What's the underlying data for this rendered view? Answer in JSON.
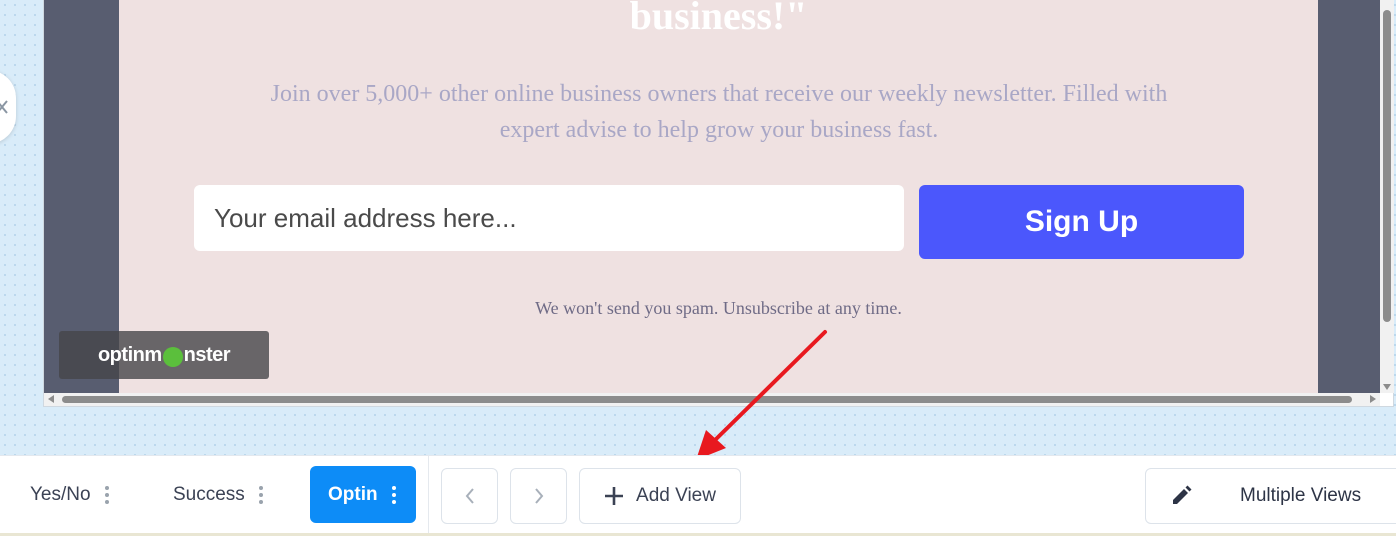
{
  "optin": {
    "headline": "business!\"",
    "subtext": "Join over 5,000+ other online business owners that receive our weekly newsletter. Filled with expert advise to help grow your business fast.",
    "email_placeholder": "Your email address here...",
    "signup_label": "Sign Up",
    "spam_note": "We won't send you spam. Unsubscribe at any time.",
    "badge": {
      "before": "optinm",
      "after": "nster"
    }
  },
  "toolbar": {
    "views": [
      {
        "label": "Yes/No",
        "active": false
      },
      {
        "label": "Success",
        "active": false
      },
      {
        "label": "Optin",
        "active": true
      }
    ],
    "add_view_label": "Add View",
    "multiple_views_label": "Multiple Views"
  },
  "colors": {
    "signup_button": "#4b57fc",
    "active_tab": "#0d8cf7",
    "card_background": "#efe1e1",
    "annotation_arrow": "#e8191f"
  }
}
